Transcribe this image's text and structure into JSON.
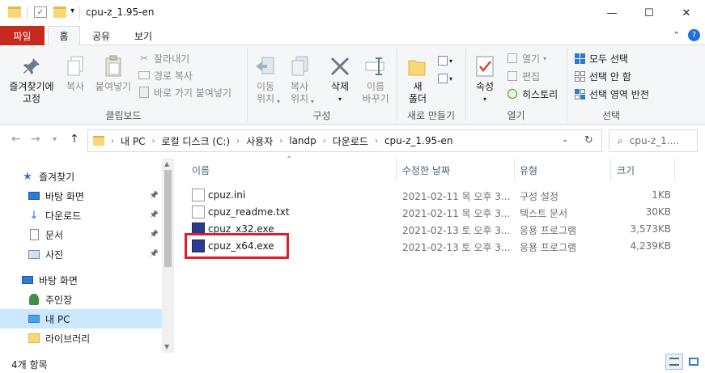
{
  "window": {
    "title": "cpu-z_1.95-en",
    "minimize": "—",
    "maximize": "☐",
    "close": "✕"
  },
  "tabs": [
    "파일",
    "홈",
    "공유",
    "보기"
  ],
  "ribbon": {
    "clipboard": {
      "pin": "즐겨찾기에\n고정",
      "copy": "복사",
      "paste": "붙여넣기",
      "cut": "잘라내기",
      "copy_path": "경로 복사",
      "paste_shortcut": "바로 가기 붙여넣기",
      "label": "클립보드"
    },
    "organize": {
      "move_to": "이동\n위치",
      "copy_to": "복사\n위치",
      "delete": "삭제",
      "rename": "이름\n바꾸기",
      "label": "구성"
    },
    "new": {
      "new_folder": "새\n폴더",
      "label": "새로 만들기"
    },
    "open": {
      "properties": "속성",
      "open": "열기",
      "edit": "편집",
      "history": "히스토리",
      "label": "열기"
    },
    "select": {
      "select_all": "모두 선택",
      "select_none": "선택 안 함",
      "invert": "선택 영역 반전",
      "label": "선택"
    }
  },
  "address": {
    "crumbs": [
      "내 PC",
      "로컬 디스크 (C:)",
      "사용자",
      "landp",
      "다운로드",
      "cpu-z_1.95-en"
    ],
    "search_placeholder": "cpu-z_1...."
  },
  "navpane": {
    "items": [
      {
        "label": "즐겨찾기",
        "icon": "star-icon"
      },
      {
        "label": "바탕 화면",
        "icon": "desktop-icon"
      },
      {
        "label": "다운로드",
        "icon": "download-icon"
      },
      {
        "label": "문서",
        "icon": "document-icon"
      },
      {
        "label": "사진",
        "icon": "pictures-icon"
      },
      {
        "label": "바탕 화면",
        "icon": "desktop-icon"
      },
      {
        "label": "주인장",
        "icon": "user-icon"
      },
      {
        "label": "내 PC",
        "icon": "pc-icon"
      },
      {
        "label": "라이브러리",
        "icon": "library-icon"
      }
    ]
  },
  "filelist": {
    "headers": {
      "name": "이름",
      "modified": "수정한 날짜",
      "type": "유형",
      "size": "크기"
    },
    "rows": [
      {
        "name": "cpuz.ini",
        "modified": "2021-02-11 목 오후 3...",
        "type": "구성 설정",
        "size": "1KB",
        "icon": "ini-file-icon"
      },
      {
        "name": "cpuz_readme.txt",
        "modified": "2021-02-11 목 오후 3...",
        "type": "텍스트 문서",
        "size": "30KB",
        "icon": "txt-file-icon"
      },
      {
        "name": "cpuz_x32.exe",
        "modified": "2021-02-13 토 오후 3...",
        "type": "응용 프로그램",
        "size": "3,573KB",
        "icon": "exe-file-icon"
      },
      {
        "name": "cpuz_x64.exe",
        "modified": "2021-02-13 토 오후 3...",
        "type": "응용 프로그램",
        "size": "4,239KB",
        "icon": "exe-file-icon"
      }
    ]
  },
  "status": {
    "count": "4개 항목"
  },
  "colors": {
    "file_tab": "#c42b1c",
    "selection": "#cce8ff",
    "highlight": "#e01e2b"
  }
}
